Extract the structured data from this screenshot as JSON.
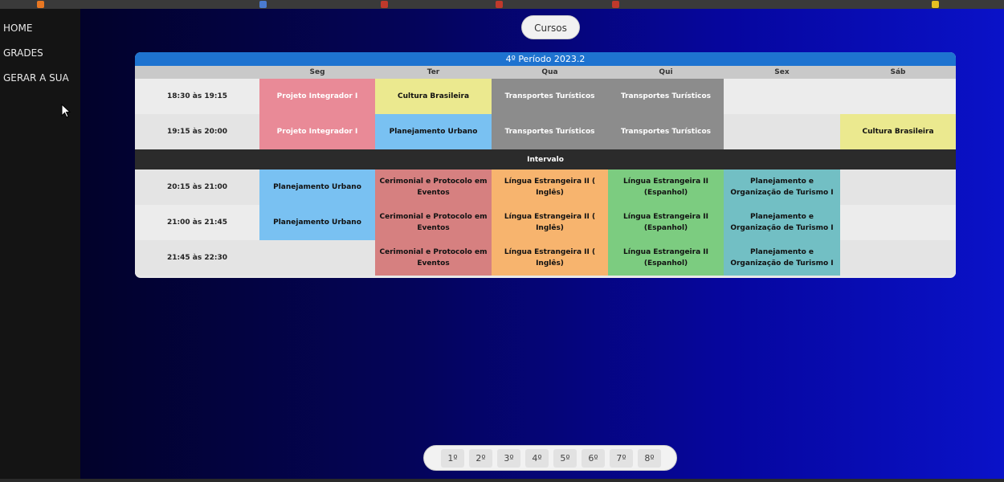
{
  "nav": {
    "items": [
      "HOME",
      "GRADES",
      "GERAR A SUA"
    ]
  },
  "header": {
    "cursos_label": "Cursos"
  },
  "schedule": {
    "title": "4º Período 2023.2",
    "days": [
      "",
      "Seg",
      "Ter",
      "Qua",
      "Qui",
      "Sex",
      "Sáb"
    ],
    "break_label": "Intervalo",
    "rows": [
      {
        "time": "18:30 às 19:15",
        "cells": [
          {
            "text": "Projeto Integrador I",
            "color": "pink"
          },
          {
            "text": "Cultura Brasileira",
            "color": "yellow"
          },
          {
            "text": "Transportes Turísticos",
            "color": "gray"
          },
          {
            "text": "Transportes Turísticos",
            "color": "gray"
          },
          {
            "text": "",
            "color": "light2"
          },
          {
            "text": "",
            "color": "light2"
          }
        ]
      },
      {
        "time": "19:15 às 20:00",
        "cells": [
          {
            "text": "Projeto Integrador I",
            "color": "pink"
          },
          {
            "text": "Planejamento Urbano",
            "color": "blue"
          },
          {
            "text": "Transportes Turísticos",
            "color": "gray"
          },
          {
            "text": "Transportes Turísticos",
            "color": "gray"
          },
          {
            "text": "",
            "color": "light"
          },
          {
            "text": "Cultura Brasileira",
            "color": "yellow"
          }
        ]
      },
      {
        "time": "20:15 às 21:00",
        "cells": [
          {
            "text": "Planejamento Urbano",
            "color": "blue"
          },
          {
            "text": "Cerimonial e Protocolo em Eventos",
            "color": "red"
          },
          {
            "text": "Língua Estrangeira II ( Inglês)",
            "color": "orange"
          },
          {
            "text": "Língua Estrangeira II (Espanhol)",
            "color": "green"
          },
          {
            "text": "Planejamento e Organização de Turismo I",
            "color": "teal"
          },
          {
            "text": "",
            "color": "light"
          }
        ]
      },
      {
        "time": "21:00 às 21:45",
        "cells": [
          {
            "text": "Planejamento Urbano",
            "color": "blue"
          },
          {
            "text": "Cerimonial e Protocolo em Eventos",
            "color": "red"
          },
          {
            "text": "Língua Estrangeira II ( Inglês)",
            "color": "orange"
          },
          {
            "text": "Língua Estrangeira II (Espanhol)",
            "color": "green"
          },
          {
            "text": "Planejamento e Organização de Turismo I",
            "color": "teal"
          },
          {
            "text": "",
            "color": "light2"
          }
        ]
      },
      {
        "time": "21:45 às 22:30",
        "cells": [
          {
            "text": "",
            "color": "light"
          },
          {
            "text": "Cerimonial e Protocolo em Eventos",
            "color": "red"
          },
          {
            "text": "Língua Estrangeira II ( Inglês)",
            "color": "orange"
          },
          {
            "text": "Língua Estrangeira II (Espanhol)",
            "color": "green"
          },
          {
            "text": "Planejamento e Organização de Turismo I",
            "color": "teal"
          },
          {
            "text": "",
            "color": "light"
          }
        ]
      }
    ]
  },
  "pager": {
    "pages": [
      "1º",
      "2º",
      "3º",
      "4º",
      "5º",
      "6º",
      "7º",
      "8º"
    ],
    "current": "4º"
  },
  "colors": {
    "pink": "#e98a97",
    "yellow": "#ebe98f",
    "gray": "#8c8c8c",
    "blue": "#79c1f2",
    "red": "#d68080",
    "orange": "#f7b46e",
    "green": "#7ccc80",
    "teal": "#72bfc4",
    "title_bar": "#1e73d0"
  }
}
